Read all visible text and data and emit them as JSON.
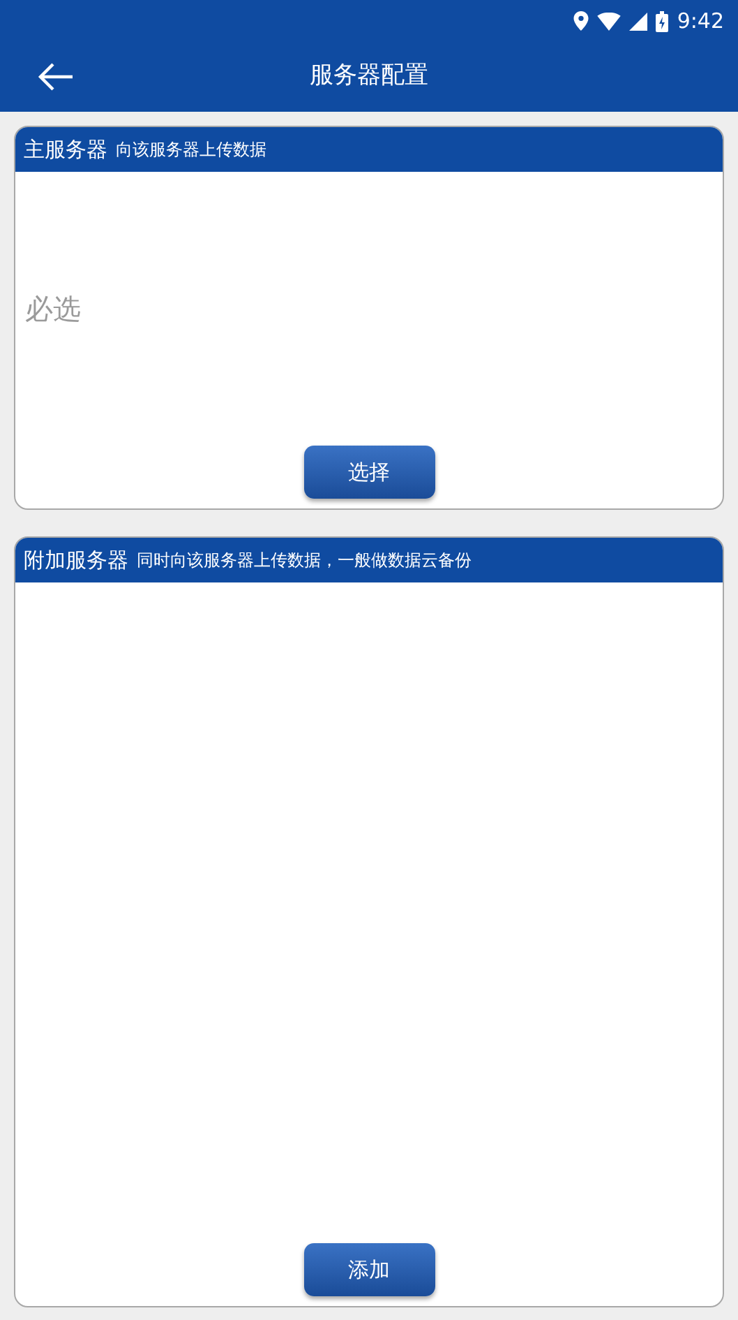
{
  "status_bar": {
    "time": "9:42"
  },
  "header": {
    "title": "服务器配置"
  },
  "sections": [
    {
      "title": "主服务器",
      "subtitle": "向该服务器上传数据",
      "empty_text": "必选",
      "button": "选择"
    },
    {
      "title": "附加服务器",
      "subtitle": "同时向该服务器上传数据，一般做数据云备份",
      "button": "添加"
    }
  ]
}
